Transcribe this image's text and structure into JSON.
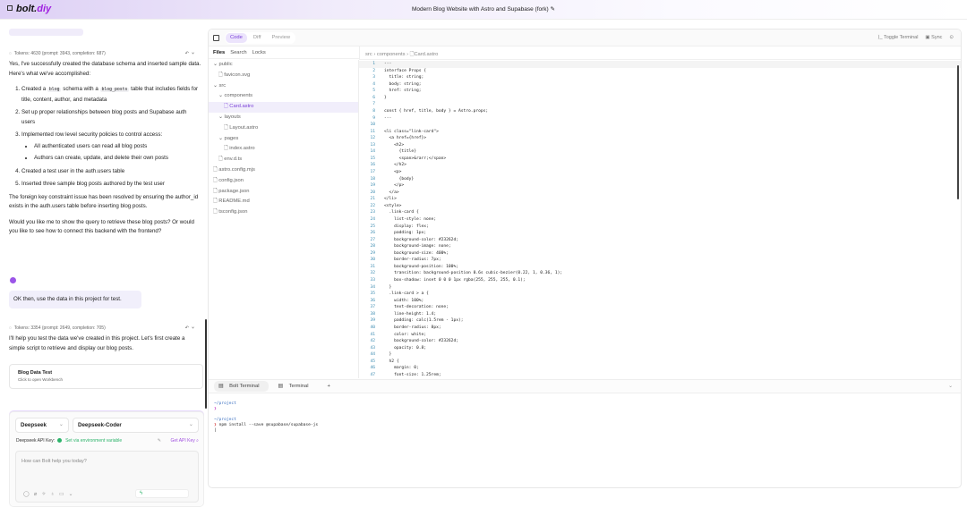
{
  "header": {
    "logo_main": "bolt.",
    "logo_accent": "diy",
    "title": "Modern Blog Website with Astro and Supabase (fork)"
  },
  "chat": {
    "msg1": {
      "tokens": "Tokens: 4630 (prompt: 3943, completion: 687)",
      "intro": "Yes, I've successfully created the database schema and inserted sample data. Here's what we've accomplished:",
      "item1_a": "Created a",
      "item1_code1": "blog",
      "item1_b": "schema with a",
      "item1_code2": "blog_posts",
      "item1_c": "table that includes fields for title, content, author, and metadata",
      "item2": "Set up proper relationships between blog posts and Supabase auth users",
      "item3": "Implemented row level security policies to control access:",
      "sub1": "All authenticated users can read all blog posts",
      "sub2": "Authors can create, update, and delete their own posts",
      "item4": "Created a test user in the auth.users table",
      "item5": "Inserted three sample blog posts authored by the test user",
      "para1": "The foreign key constraint issue has been resolved by ensuring the author_id exists in the auth.users table before inserting blog posts.",
      "para2": "Would you like me to show the query to retrieve these blog posts? Or would you like to see how to connect this backend with the frontend?"
    },
    "user_msg": "OK then,  use the data in this project for test.",
    "msg2": {
      "tokens": "Tokens: 3354 (prompt: 2649, completion: 705)",
      "text": "I'll help you test the data we've created in this project. Let's first create a simple script to retrieve and display our blog posts.",
      "card_title": "Blog Data Test",
      "card_sub": "Click to open Workbench"
    },
    "input": {
      "provider": "Deepseek",
      "model": "Deepseek-Coder",
      "key_label": "Deepseek API Key:",
      "key_status": "Set via environment variable",
      "get_key": "Get API Key",
      "placeholder": "How can Bolt help you today?"
    }
  },
  "workbench": {
    "tabs": [
      "Code",
      "Diff",
      "Preview"
    ],
    "toggle_terminal": "Toggle Terminal",
    "sync": "Sync",
    "file_tabs": [
      "Files",
      "Search",
      "Locks"
    ],
    "tree": [
      {
        "label": "public",
        "type": "folder",
        "depth": 0
      },
      {
        "label": "favicon.svg",
        "type": "file",
        "depth": 1
      },
      {
        "label": "src",
        "type": "folder",
        "depth": 0
      },
      {
        "label": "components",
        "type": "folder",
        "depth": 1
      },
      {
        "label": "Card.astro",
        "type": "file",
        "depth": 2,
        "active": true
      },
      {
        "label": "layouts",
        "type": "folder",
        "depth": 1
      },
      {
        "label": "Layout.astro",
        "type": "file",
        "depth": 2
      },
      {
        "label": "pages",
        "type": "folder",
        "depth": 1
      },
      {
        "label": "index.astro",
        "type": "file",
        "depth": 2
      },
      {
        "label": "env.d.ts",
        "type": "file",
        "depth": 1
      },
      {
        "label": "astro.config.mjs",
        "type": "file",
        "depth": 0
      },
      {
        "label": "config.json",
        "type": "file",
        "depth": 0
      },
      {
        "label": "package.json",
        "type": "file",
        "depth": 0
      },
      {
        "label": "README.md",
        "type": "file",
        "depth": 0
      },
      {
        "label": "tsconfig.json",
        "type": "file",
        "depth": 0
      }
    ],
    "breadcrumb": [
      "src",
      "components",
      "Card.astro"
    ],
    "code": [
      "---",
      "interface Props {",
      "  title: string;",
      "  body: string;",
      "  href: string;",
      "}",
      "",
      "const { href, title, body } = Astro.props;",
      "---",
      "",
      "<li class=\"link-card\">",
      "  <a href={href}>",
      "    <h2>",
      "      {title}",
      "      <span>&rarr;</span>",
      "    </h2>",
      "    <p>",
      "      {body}",
      "    </p>",
      "  </a>",
      "</li>",
      "<style>",
      "  .link-card {",
      "    list-style: none;",
      "    display: flex;",
      "    padding: 1px;",
      "    background-color: #23262d;",
      "    background-image: none;",
      "    background-size: 400%;",
      "    border-radius: 7px;",
      "    background-position: 100%;",
      "    transition: background-position 0.6s cubic-bezier(0.22, 1, 0.36, 1);",
      "    box-shadow: inset 0 0 0 1px rgba(255, 255, 255, 0.1);",
      "  }",
      "  .link-card > a {",
      "    width: 100%;",
      "    text-decoration: none;",
      "    line-height: 1.4;",
      "    padding: calc(1.5rem - 1px);",
      "    border-radius: 8px;",
      "    color: white;",
      "    background-color: #23262d;",
      "    opacity: 0.8;",
      "  }",
      "  h2 {",
      "    margin: 0;",
      "    font-size: 1.25rem;"
    ],
    "terminal_tabs": [
      "Bolt Terminal",
      "Terminal"
    ],
    "terminal": {
      "path1": "~/project",
      "prompt": "❯",
      "path2": "~/project",
      "command": "npm install --save @supabase/supabase-js"
    }
  }
}
